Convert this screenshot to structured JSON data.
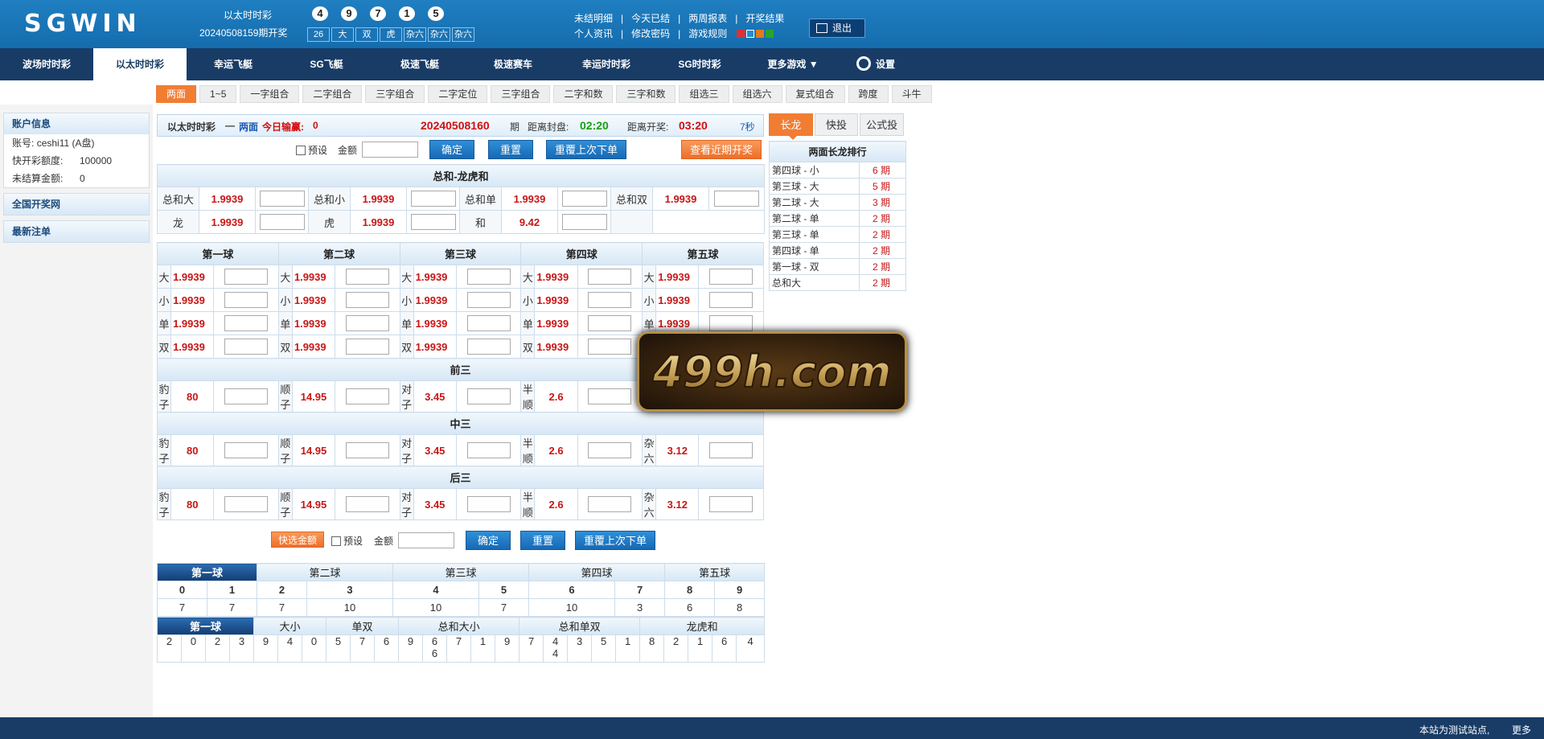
{
  "header": {
    "logo": "SGWIN",
    "lottery_name": "以太时时彩",
    "last_issue": "20240508159期开奖",
    "balls": [
      "4",
      "9",
      "7",
      "1",
      "5"
    ],
    "tags": [
      "26",
      "大",
      "双",
      "虎",
      "杂六",
      "杂六",
      "杂六"
    ],
    "links_row1": [
      "未结明细",
      "|",
      "今天已结",
      "|",
      "两周报表",
      "|",
      "开奖结果"
    ],
    "links_row2": [
      "个人资讯",
      "|",
      "修改密码",
      "|",
      "游戏规则"
    ],
    "swatch_colors": [
      "#e03030",
      "#1e90d0",
      "#e07a20",
      "#2aa52a"
    ],
    "logout": "退出"
  },
  "nav": {
    "items": [
      "波场时时彩",
      "以太时时彩",
      "幸运飞艇",
      "SG飞艇",
      "极速飞艇",
      "极速赛车",
      "幸运时时彩",
      "SG时时彩",
      "更多游戏 ▼"
    ],
    "settings": "设置"
  },
  "subtabs": [
    "两面",
    "1~5",
    "一字组合",
    "二字组合",
    "三字组合",
    "二字定位",
    "三字组合",
    "二字和数",
    "三字和数",
    "组选三",
    "组选六",
    "复式组合",
    "跨度",
    "斗牛"
  ],
  "sidebar": {
    "account_title": "账户信息",
    "account_label": "账号:",
    "account_value": "ceshi11 (A盘)",
    "quota_label": "快开彩额度:",
    "quota_value": "100000",
    "unsettled_label": "未结算金额:",
    "unsettled_value": "0",
    "national": "全国开奖网",
    "latest": "最新注单"
  },
  "infobar": {
    "lottery": "以太时时彩",
    "dash": "—",
    "play": "两面",
    "pnl_label": "今日输赢:",
    "pnl_value": "0",
    "issue": "20240508160",
    "issue_suffix": "期",
    "close_label": "距离封盘:",
    "close_time": "02:20",
    "draw_label": "距离开奖:",
    "draw_time": "03:20",
    "refresh": "7秒"
  },
  "controls": {
    "preset": "预设",
    "amount": "金额",
    "confirm": "确定",
    "reset": "重置",
    "repeat": "重覆上次下单",
    "recent": "查看近期开奖",
    "quick": "快选金额"
  },
  "sum": {
    "title": "总和-龙虎和",
    "row1": [
      [
        "总和大",
        "1.9939"
      ],
      [
        "总和小",
        "1.9939"
      ],
      [
        "总和单",
        "1.9939"
      ],
      [
        "总和双",
        "1.9939"
      ]
    ],
    "row2": [
      [
        "龙",
        "1.9939"
      ],
      [
        "虎",
        "1.9939"
      ],
      [
        "和",
        "9.42"
      ]
    ]
  },
  "balls_table": {
    "headers": [
      "第一球",
      "第二球",
      "第三球",
      "第四球",
      "第五球"
    ],
    "rows": [
      {
        "label": "大",
        "odds": "1.9939"
      },
      {
        "label": "小",
        "odds": "1.9939"
      },
      {
        "label": "单",
        "odds": "1.9939"
      },
      {
        "label": "双",
        "odds": "1.9939"
      }
    ]
  },
  "groups": [
    {
      "title": "前三",
      "items": [
        [
          "豹子",
          "80"
        ],
        [
          "顺子",
          "14.95"
        ],
        [
          "对子",
          "3.45"
        ],
        [
          "半顺",
          "2.6"
        ],
        [
          "杂六",
          "3.12"
        ]
      ]
    },
    {
      "title": "中三",
      "items": [
        [
          "豹子",
          "80"
        ],
        [
          "顺子",
          "14.95"
        ],
        [
          "对子",
          "3.45"
        ],
        [
          "半顺",
          "2.6"
        ],
        [
          "杂六",
          "3.12"
        ]
      ]
    },
    {
      "title": "后三",
      "items": [
        [
          "豹子",
          "80"
        ],
        [
          "顺子",
          "14.95"
        ],
        [
          "对子",
          "3.45"
        ],
        [
          "半顺",
          "2.6"
        ],
        [
          "杂六",
          "3.12"
        ]
      ]
    }
  ],
  "stats": {
    "ball_tabs": [
      "第一球",
      "第二球",
      "第三球",
      "第四球",
      "第五球"
    ],
    "digits": [
      "0",
      "1",
      "2",
      "3",
      "4",
      "5",
      "6",
      "7",
      "8",
      "9"
    ],
    "counts": [
      "7",
      "7",
      "7",
      "10",
      "10",
      "7",
      "10",
      "3",
      "6",
      "8"
    ],
    "trend_tabs": [
      "第一球",
      "大小",
      "单双",
      "总和大小",
      "总和单双",
      "龙虎和"
    ],
    "trend_values": [
      "2",
      "0",
      "2",
      "3",
      "9",
      "4",
      "0",
      "5",
      "7",
      "6",
      "9",
      "6",
      "7",
      "1",
      "9",
      "7",
      "4",
      "3",
      "5",
      "1",
      "8",
      "2",
      "1",
      "6",
      "4"
    ],
    "trend_second": {
      "11": "6",
      "16": "4"
    }
  },
  "right": {
    "tabs": [
      "长龙",
      "快投",
      "公式投"
    ],
    "title": "两面长龙排行",
    "rows": [
      [
        "第四球 - 小",
        "6 期"
      ],
      [
        "第三球 - 大",
        "5 期"
      ],
      [
        "第二球 - 大",
        "3 期"
      ],
      [
        "第二球 - 单",
        "2 期"
      ],
      [
        "第三球 - 单",
        "2 期"
      ],
      [
        "第四球 - 单",
        "2 期"
      ],
      [
        "第一球 - 双",
        "2 期"
      ],
      [
        "总和大",
        "2 期"
      ]
    ]
  },
  "watermark": "499h.com",
  "footer": {
    "notice": "本站为测试站点,",
    "more": "更多"
  }
}
